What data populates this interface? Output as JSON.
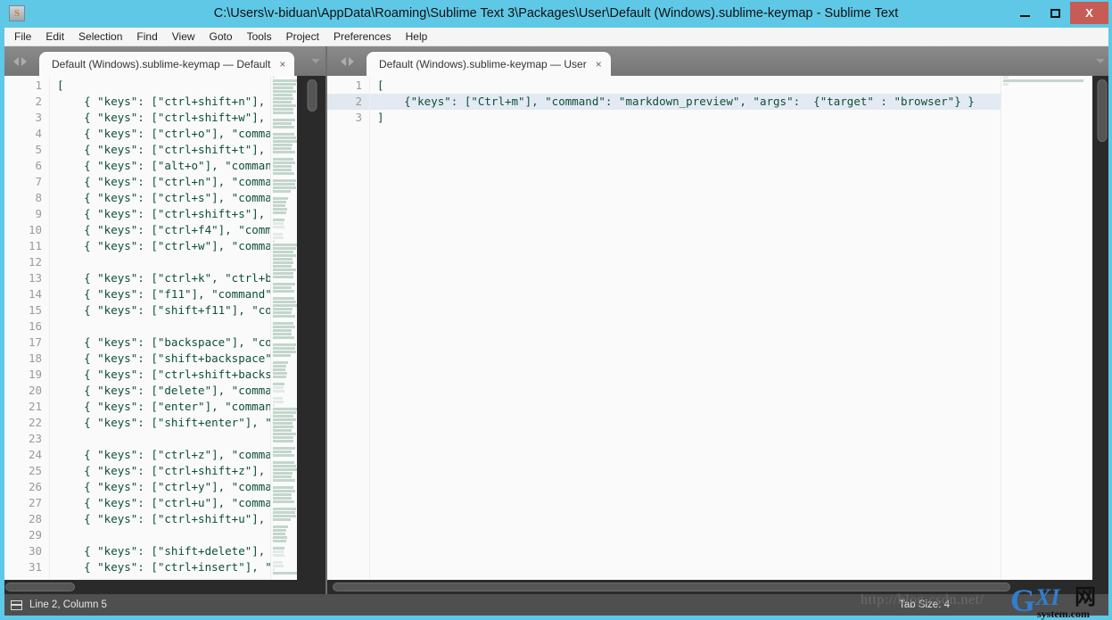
{
  "window": {
    "title": "C:\\Users\\v-biduan\\AppData\\Roaming\\Sublime Text 3\\Packages\\User\\Default (Windows).sublime-keymap - Sublime Text",
    "app_icon": "sublime-text-icon",
    "controls": {
      "minimize": "–",
      "maximize": "□",
      "close": "X"
    },
    "accent_color": "#5ec8e8",
    "close_color": "#c75b56"
  },
  "menubar": {
    "items": [
      {
        "label": "File"
      },
      {
        "label": "Edit"
      },
      {
        "label": "Selection"
      },
      {
        "label": "Find"
      },
      {
        "label": "View"
      },
      {
        "label": "Goto"
      },
      {
        "label": "Tools"
      },
      {
        "label": "Project"
      },
      {
        "label": "Preferences"
      },
      {
        "label": "Help"
      }
    ]
  },
  "panes": {
    "left": {
      "tab": {
        "label": "Default (Windows).sublime-keymap — Default",
        "close": "×"
      },
      "lines": [
        {
          "n": "1",
          "text": "["
        },
        {
          "n": "2",
          "text": "    { \"keys\": [\"ctrl+shift+n\"],"
        },
        {
          "n": "3",
          "text": "    { \"keys\": [\"ctrl+shift+w\"],"
        },
        {
          "n": "4",
          "text": "    { \"keys\": [\"ctrl+o\"], \"comma"
        },
        {
          "n": "5",
          "text": "    { \"keys\": [\"ctrl+shift+t\"],"
        },
        {
          "n": "6",
          "text": "    { \"keys\": [\"alt+o\"], \"comman"
        },
        {
          "n": "7",
          "text": "    { \"keys\": [\"ctrl+n\"], \"comma"
        },
        {
          "n": "8",
          "text": "    { \"keys\": [\"ctrl+s\"], \"comma"
        },
        {
          "n": "9",
          "text": "    { \"keys\": [\"ctrl+shift+s\"],"
        },
        {
          "n": "10",
          "text": "    { \"keys\": [\"ctrl+f4\"], \"comm"
        },
        {
          "n": "11",
          "text": "    { \"keys\": [\"ctrl+w\"], \"comma"
        },
        {
          "n": "12",
          "text": ""
        },
        {
          "n": "13",
          "text": "    { \"keys\": [\"ctrl+k\", \"ctrl+b"
        },
        {
          "n": "14",
          "text": "    { \"keys\": [\"f11\"], \"command\""
        },
        {
          "n": "15",
          "text": "    { \"keys\": [\"shift+f11\"], \"co"
        },
        {
          "n": "16",
          "text": ""
        },
        {
          "n": "17",
          "text": "    { \"keys\": [\"backspace\"], \"co"
        },
        {
          "n": "18",
          "text": "    { \"keys\": [\"shift+backspace\""
        },
        {
          "n": "19",
          "text": "    { \"keys\": [\"ctrl+shift+backs"
        },
        {
          "n": "20",
          "text": "    { \"keys\": [\"delete\"], \"comma"
        },
        {
          "n": "21",
          "text": "    { \"keys\": [\"enter\"], \"comman"
        },
        {
          "n": "22",
          "text": "    { \"keys\": [\"shift+enter\"], \""
        },
        {
          "n": "23",
          "text": ""
        },
        {
          "n": "24",
          "text": "    { \"keys\": [\"ctrl+z\"], \"comma"
        },
        {
          "n": "25",
          "text": "    { \"keys\": [\"ctrl+shift+z\"],"
        },
        {
          "n": "26",
          "text": "    { \"keys\": [\"ctrl+y\"], \"comma"
        },
        {
          "n": "27",
          "text": "    { \"keys\": [\"ctrl+u\"], \"comma"
        },
        {
          "n": "28",
          "text": "    { \"keys\": [\"ctrl+shift+u\"],"
        },
        {
          "n": "29",
          "text": ""
        },
        {
          "n": "30",
          "text": "    { \"keys\": [\"shift+delete\"],"
        },
        {
          "n": "31",
          "text": "    { \"keys\": [\"ctrl+insert\"], \""
        }
      ]
    },
    "right": {
      "tab": {
        "label": "Default (Windows).sublime-keymap — User",
        "close": "×"
      },
      "active_line": 2,
      "lines": [
        {
          "n": "1",
          "text": "["
        },
        {
          "n": "2",
          "text": "    {\"keys\": [\"Ctrl+m\"], \"command\": \"markdown_preview\", \"args\":  {\"target\" : \"browser\"} }"
        },
        {
          "n": "3",
          "text": "]"
        }
      ]
    }
  },
  "statusbar": {
    "cursor": "Line 2, Column 5",
    "tab_size": "Tab Size: 4",
    "icon": "layout-icon"
  },
  "watermark": {
    "url": "http://blog.csdn.net/",
    "logo_g": "G",
    "logo_xi": "XI",
    "logo_cn": "网",
    "logo_sub": "system.com"
  }
}
